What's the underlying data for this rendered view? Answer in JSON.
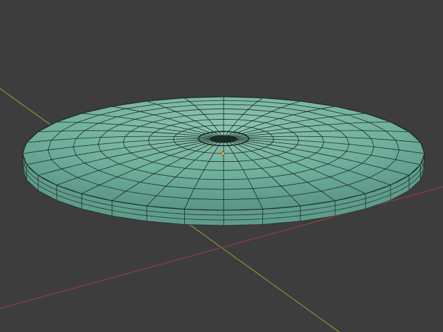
{
  "viewport": {
    "background_color": "#3d3d3d",
    "grid_axes": {
      "x_axis_color": "#9a3b46",
      "y_axis_color": "#7f9a3c"
    }
  },
  "mesh": {
    "object_type": "dome-disc",
    "face_color": "#6fae9b",
    "face_color_highlight": "#8cc4b1",
    "face_color_shadow": "#5a9585",
    "rim_color": "#5f9c8b",
    "wire_color": "#1a2a25",
    "radial_segments": 32,
    "rings": 8,
    "origin_color": "#f0a020"
  }
}
